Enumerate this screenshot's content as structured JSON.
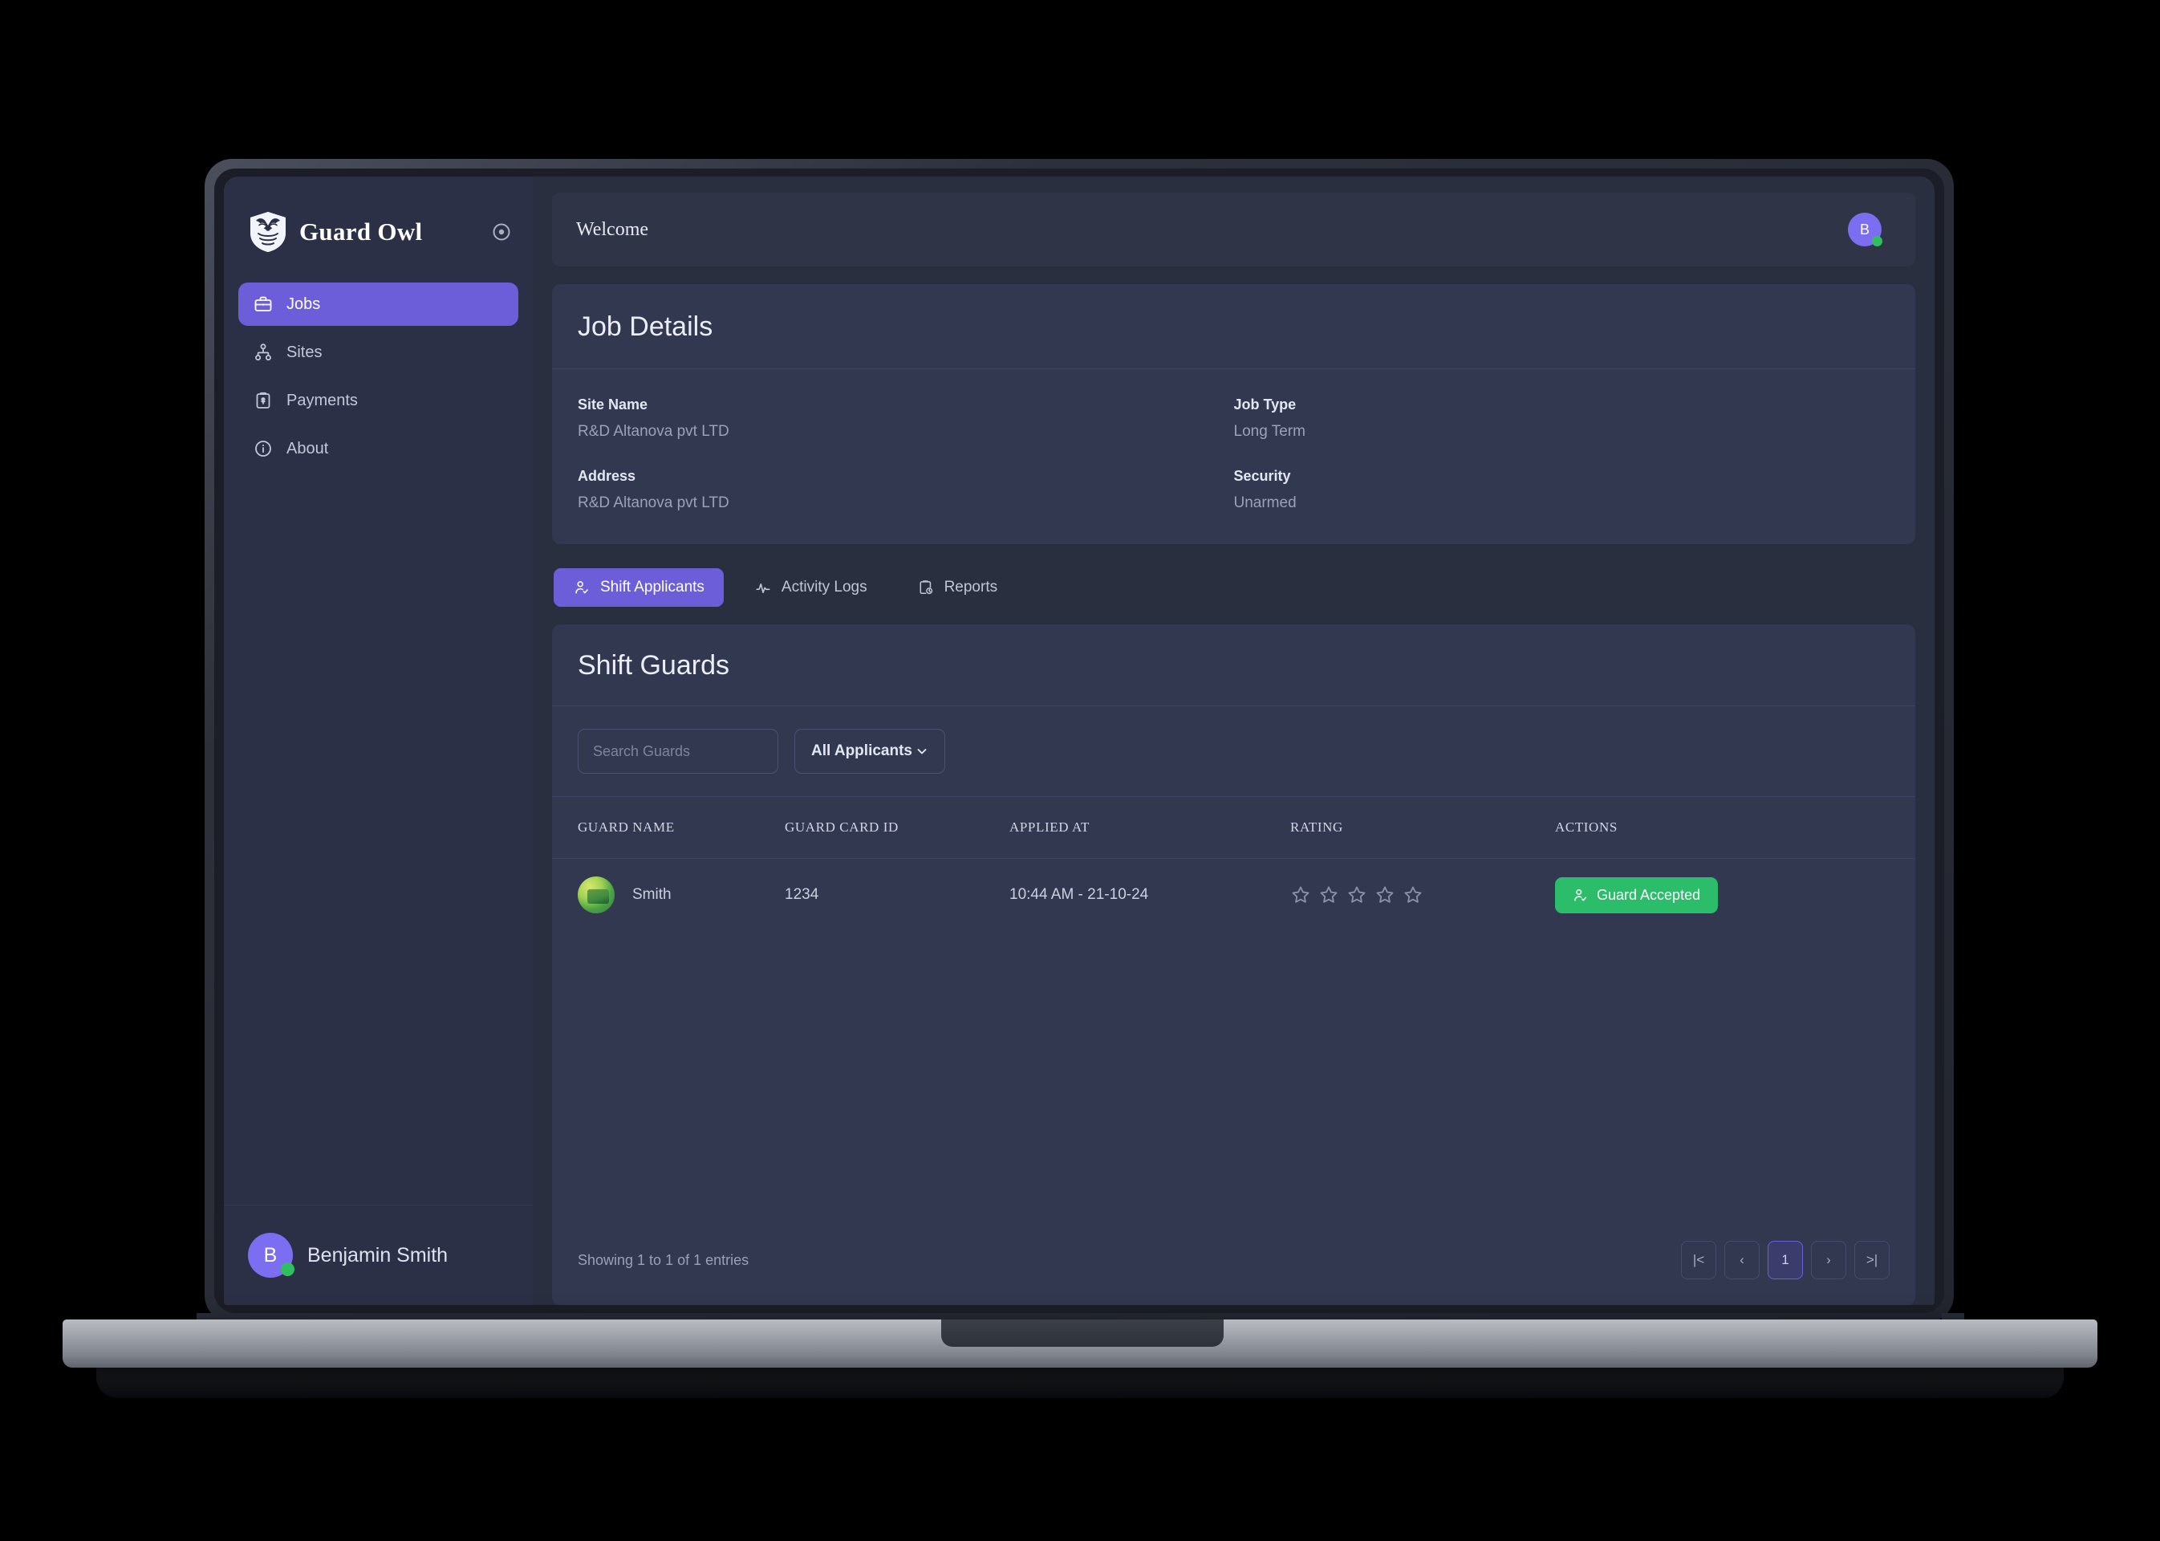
{
  "brand": {
    "name": "Guard Owl",
    "logo_icon": "owl-shield-icon",
    "toggle_icon": "circle-dot-toggle-icon"
  },
  "sidebar": {
    "items": [
      {
        "label": "Jobs",
        "icon": "briefcase-icon",
        "active": true
      },
      {
        "label": "Sites",
        "icon": "sitemap-icon",
        "active": false
      },
      {
        "label": "Payments",
        "icon": "clipboard-dollar-icon",
        "active": false
      },
      {
        "label": "About",
        "icon": "info-circle-icon",
        "active": false
      }
    ],
    "user": {
      "name": "Benjamin Smith",
      "initial": "B",
      "status": "online"
    }
  },
  "topbar": {
    "title": "Welcome",
    "avatar_initial": "B",
    "status": "online"
  },
  "job_details": {
    "title": "Job Details",
    "fields": [
      {
        "label": "Site Name",
        "value": "R&D Altanova pvt LTD"
      },
      {
        "label": "Job Type",
        "value": "Long Term"
      },
      {
        "label": "Address",
        "value": "R&D Altanova pvt LTD"
      },
      {
        "label": "Security",
        "value": "Unarmed"
      }
    ]
  },
  "tabs": [
    {
      "label": "Shift Applicants",
      "icon": "user-check-icon",
      "active": true
    },
    {
      "label": "Activity Logs",
      "icon": "activity-pulse-icon",
      "active": false
    },
    {
      "label": "Reports",
      "icon": "clipboard-report-icon",
      "active": false
    }
  ],
  "shift_guards": {
    "title": "Shift Guards",
    "search": {
      "placeholder": "Search Guards",
      "value": ""
    },
    "filter": {
      "selected": "All Applicants",
      "options": [
        "All Applicants"
      ]
    },
    "columns": [
      "GUARD NAME",
      "GUARD CARD ID",
      "APPLIED AT",
      "RATING",
      "ACTIONS"
    ],
    "rows": [
      {
        "guard_name": "Smith",
        "guard_card_id": "1234",
        "applied_at": "10:44 AM - 21-10-24",
        "rating": 0,
        "rating_max": 5,
        "action_label": "Guard Accepted",
        "action_state": "accepted"
      }
    ],
    "footer": {
      "showing": "Showing 1 to 1 of 1 entries",
      "pager": [
        {
          "label": "|<",
          "name": "first",
          "current": false
        },
        {
          "label": "‹",
          "name": "prev",
          "current": false
        },
        {
          "label": "1",
          "name": "page-1",
          "current": true
        },
        {
          "label": "›",
          "name": "next",
          "current": false
        },
        {
          "label": ">|",
          "name": "last",
          "current": false
        }
      ]
    }
  },
  "colors": {
    "accent": "#6c5dd8",
    "accent_light": "#7b6ef0",
    "success": "#2bbd6a",
    "online": "#2fbf5e",
    "sidebar_bg": "#2b3046",
    "content_bg": "#2a2f3f",
    "card_bg": "#323850",
    "topbar_bg": "#2f3446",
    "border": "#3c4360",
    "text_primary": "#eceef6",
    "text_muted": "#9ba1b8"
  }
}
